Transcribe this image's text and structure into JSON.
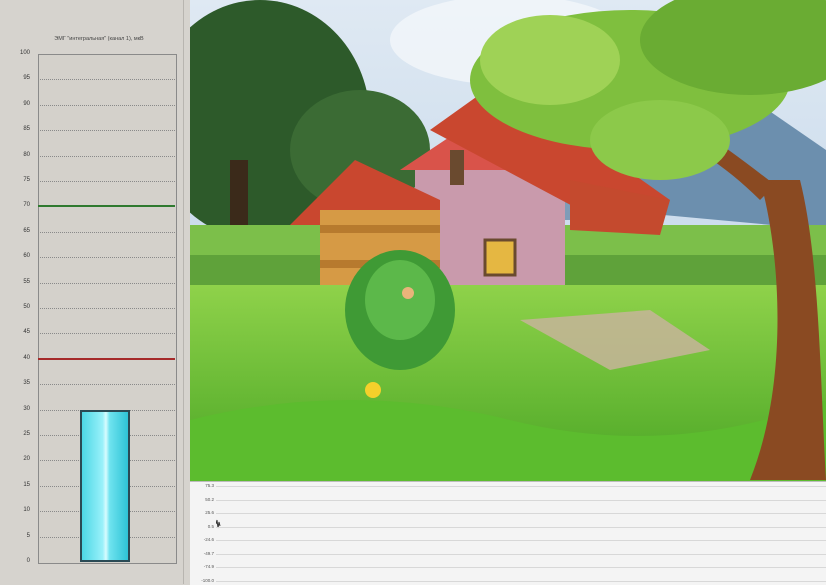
{
  "gauge": {
    "title": "ЭМГ \"интегральная\" (канал 1), мкВ",
    "y_ticks": [
      "100",
      "95",
      "90",
      "85",
      "80",
      "75",
      "70",
      "65",
      "60",
      "55",
      "50",
      "45",
      "40",
      "35",
      "30",
      "25",
      "20",
      "15",
      "10",
      "5",
      "0"
    ],
    "ylim": [
      0,
      100
    ],
    "upper_threshold": 70,
    "lower_threshold": 40,
    "bar_value": 30,
    "colors": {
      "upper_threshold": "#2f7a2f",
      "lower_threshold": "#a52a2a",
      "bar": "#4cd7e6"
    }
  },
  "scene": {
    "description_icon": "cartoon-house-landscape"
  },
  "strip": {
    "y_ticks": [
      "75.3",
      "50.2",
      "25.6",
      "0.5",
      "-24.6",
      "-49.7",
      "-74.9",
      "-100.0"
    ]
  }
}
